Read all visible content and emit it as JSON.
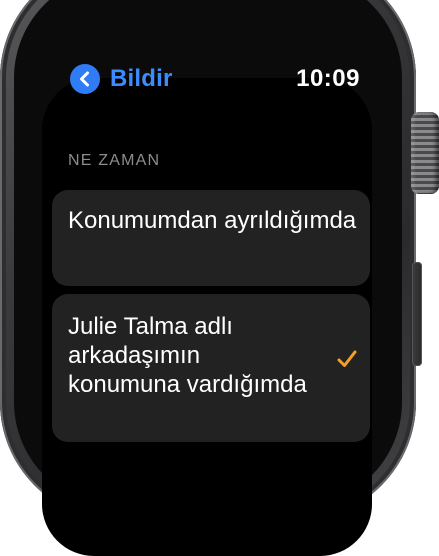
{
  "nav": {
    "back_label": "Bildir",
    "time": "10:09"
  },
  "section": {
    "header": "NE ZAMAN"
  },
  "options": [
    {
      "label": "Konumumdan ayrıldığımda",
      "selected": false
    },
    {
      "label": "Julie Talma adlı arkadaşımın konumuna vardığımda",
      "selected": true
    }
  ],
  "colors": {
    "accent_blue": "#2f7cf6",
    "check_orange": "#f5a025",
    "cell_background": "#222223",
    "secondary_text": "#8c8c91"
  },
  "icons": {
    "back": "chevron-left-icon",
    "selected": "checkmark-icon"
  }
}
